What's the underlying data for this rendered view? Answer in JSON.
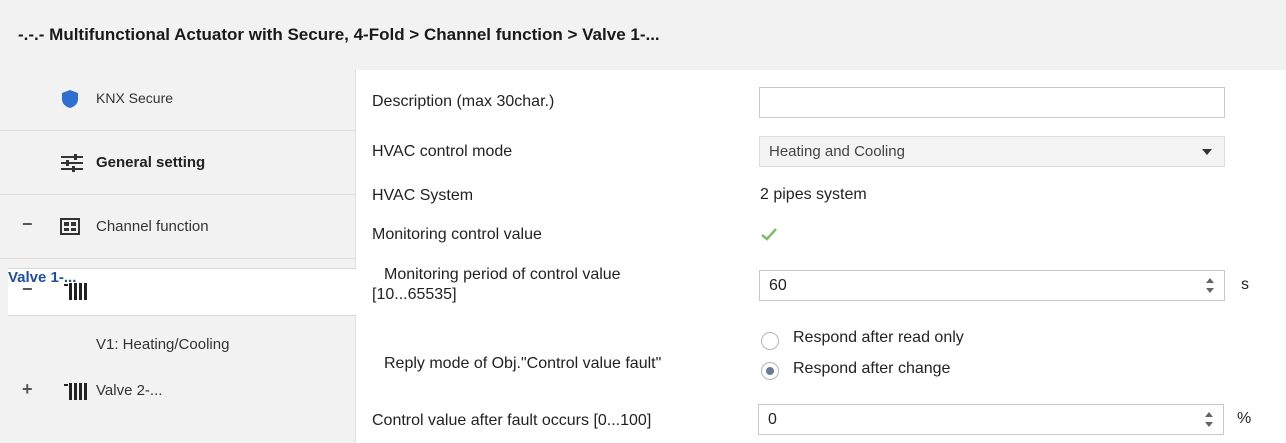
{
  "title": "-.-.- Multifunctional Actuator with Secure, 4-Fold > Channel function > Valve 1-...",
  "sidebar": {
    "items": [
      {
        "label": "KNX Secure",
        "icon": "shield-icon"
      },
      {
        "label": "General setting",
        "icon": "sliders-icon"
      },
      {
        "label": "Channel function",
        "icon": "channel-icon",
        "expander": "−"
      },
      {
        "label": "Valve 1-...",
        "icon": "radiator-icon",
        "expander": "−",
        "selected": true
      },
      {
        "label": "V1: Heating/Cooling"
      },
      {
        "label": "Valve 2-...",
        "icon": "radiator-icon",
        "expander": "+"
      }
    ]
  },
  "params": {
    "description": {
      "label": "Description (max 30char.)",
      "value": ""
    },
    "hvac_mode": {
      "label": "HVAC control mode",
      "value": "Heating and Cooling"
    },
    "hvac_system": {
      "label": "HVAC System",
      "value": "2 pipes system"
    },
    "monitoring": {
      "label": "Monitoring control value",
      "checked": true
    },
    "monitoring_period": {
      "label_line1": "Monitoring period of control value",
      "label_line2": "[10...65535]",
      "value": "60",
      "unit": "s"
    },
    "reply_mode": {
      "label": "Reply mode of Obj.\"Control value fault\"",
      "options": [
        {
          "label": "Respond after read only",
          "selected": false
        },
        {
          "label": "Respond after change",
          "selected": true
        }
      ]
    },
    "fault_value": {
      "label": "Control value after fault occurs [0...100]",
      "value": "0",
      "unit": "%"
    }
  },
  "colors": {
    "accent": "#1f4fa0",
    "check": "#7cbf6a",
    "shield": "#2f6fd0"
  }
}
